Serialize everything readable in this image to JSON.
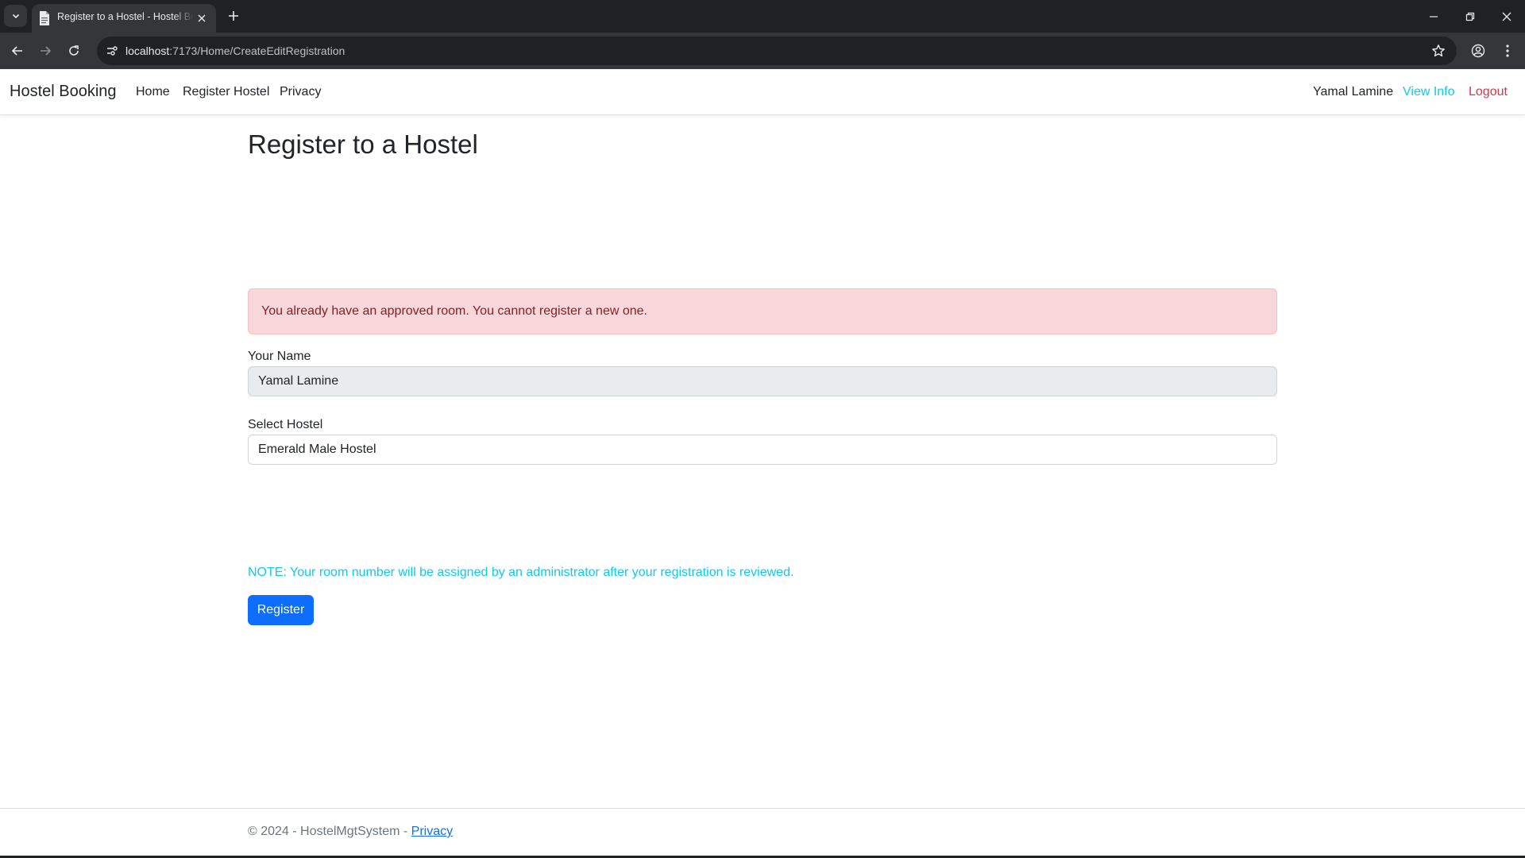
{
  "browser": {
    "tab_title": "Register to a Hostel - Hostel Booking",
    "url_host": "localhost",
    "url_path": ":7173/Home/CreateEditRegistration"
  },
  "navbar": {
    "brand": "Hostel Booking",
    "links": [
      {
        "label": "Home"
      },
      {
        "label": "Register Hostel"
      },
      {
        "label": "Privacy"
      }
    ],
    "user_name": "Yamal Lamine",
    "view_info": "View Info",
    "logout": "Logout"
  },
  "main": {
    "title": "Register to a Hostel",
    "alert": "You already have an approved room. You cannot register a new one.",
    "name_label": "Your Name",
    "name_value": "Yamal Lamine",
    "hostel_label": "Select Hostel",
    "hostel_value": "Emerald Male Hostel",
    "note": "NOTE: Your room number will be assigned by an administrator after your registration is reviewed.",
    "register_button": "Register"
  },
  "footer": {
    "text": "© 2024 - HostelMgtSystem - ",
    "privacy_link": "Privacy"
  },
  "colors": {
    "primary": "#0d6efd",
    "info": "#0dcaf0",
    "danger": "#dc3545",
    "alert_bg": "#f8d7da",
    "alert_text": "#842029"
  }
}
